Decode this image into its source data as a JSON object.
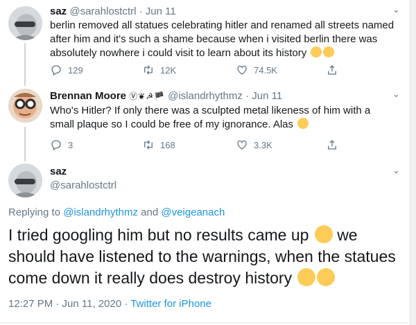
{
  "tweets": [
    {
      "name": "saz",
      "handle": "@sarahlostctrl",
      "sep": "·",
      "date": "Jun 11",
      "text": "berlin removed all statues celebrating hitler and renamed all streets named after him and it's such a shame because when i visited berlin there was absolutely nowhere i could visit to learn about its history",
      "replies": "129",
      "retweets": "12K",
      "likes": "74.5K"
    },
    {
      "name": "Brennan Moore",
      "badges": "Ⓥ❦☭🏴",
      "handle": "@islandrhythmz",
      "sep": "·",
      "date": "Jun 11",
      "text": "Who's Hitler? If only there was a sculpted metal likeness of him with a small plaque so I could be free of my ignorance. Alas",
      "replies": "3",
      "retweets": "168",
      "likes": "3.3K"
    }
  ],
  "main": {
    "name": "saz",
    "handle": "@sarahlostctrl",
    "replying_prefix": "Replying to",
    "replying_user1": "@islandrhythmz",
    "replying_and": "and",
    "replying_user2": "@veigeanach",
    "text_part1": "I tried googling him but no results came up",
    "text_part2": "we should have listened to the warnings, when the statues come down it really does destroy history",
    "time": "12:27 PM · Jun 11, 2020",
    "source_sep": "·",
    "source": "Twitter for iPhone"
  },
  "colors": {
    "accent": "#1b95e0",
    "secondary_text": "#657786",
    "emoji": "#fdcb58"
  },
  "icons": [
    "reply-icon",
    "retweet-icon",
    "like-icon",
    "share-icon",
    "chevron-down-icon"
  ]
}
